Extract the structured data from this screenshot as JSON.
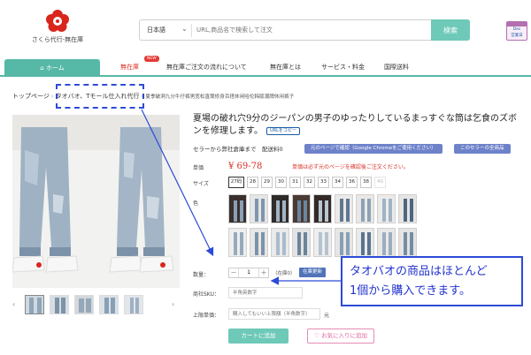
{
  "header": {
    "logo_text": "さくら代行-無在庫",
    "search": {
      "language": "日本語",
      "placeholder": "URL,商品名で検索して注文",
      "button_label": "検索"
    },
    "calendar_badge": {
      "line1": "Dec",
      "line2": "営業日"
    }
  },
  "nav": {
    "home": "ホーム",
    "items": [
      "無在庫",
      "無在庫ご注文の流れについて",
      "無在庫とは",
      "サービス・料金",
      "国際送料"
    ],
    "new_badge": "NEW"
  },
  "breadcrumb": {
    "root": "トップページ",
    "category": "タオバオ、Tモール仕入れ代行",
    "tail": "夏季破洞九分牛仔裤男宽松直筒修身百搭休闲哈伦韩版潮牌休闲裤子"
  },
  "product": {
    "title": "夏場の破れ穴9分のジーパンの男子のゆったりしているまっすぐな筒は乞食のズボンを修理します。",
    "url_copy": "URLをコピー",
    "shipping_text": "セラーから弊社倉庫まで　配送料0",
    "btn_original_page": "元のページで確認（Google Chromeをご使用ください）",
    "btn_seller_all": "このセラーの全商品",
    "price_label": "単価",
    "price": "¥ 69-78",
    "price_note": "単価は必ず元のページを確認後ご注文ください。",
    "size_label": "サイズ",
    "sizes": [
      "27码",
      "28",
      "29",
      "30",
      "31",
      "32",
      "33",
      "34",
      "36",
      "38",
      "40"
    ],
    "color_label": "色",
    "qty_label": "数量：",
    "qty_minus": "－",
    "qty_value": "1",
    "qty_plus": "＋",
    "stock_note": "（在庫0）",
    "stock_btn": "在庫更新",
    "sku_label": "商社SKU：",
    "sku_placeholder": "半角英数字",
    "limit_label": "上限単価：",
    "limit_placeholder": "購入してもいい上限額（半角数字）",
    "limit_suffix": "元",
    "cart_btn": "カートに追加",
    "fav_btn": "お気に入りに追加",
    "thumb_prev": "‹",
    "thumb_next": "›"
  },
  "annotation": {
    "line1": "タオバオの商品はほとんど",
    "line2": "1個から購入できます。"
  },
  "colors": {
    "accent": "#56b8a6",
    "price": "#d93025",
    "annotation": "#2d4bd6",
    "button_blue": "#6d82c9"
  }
}
